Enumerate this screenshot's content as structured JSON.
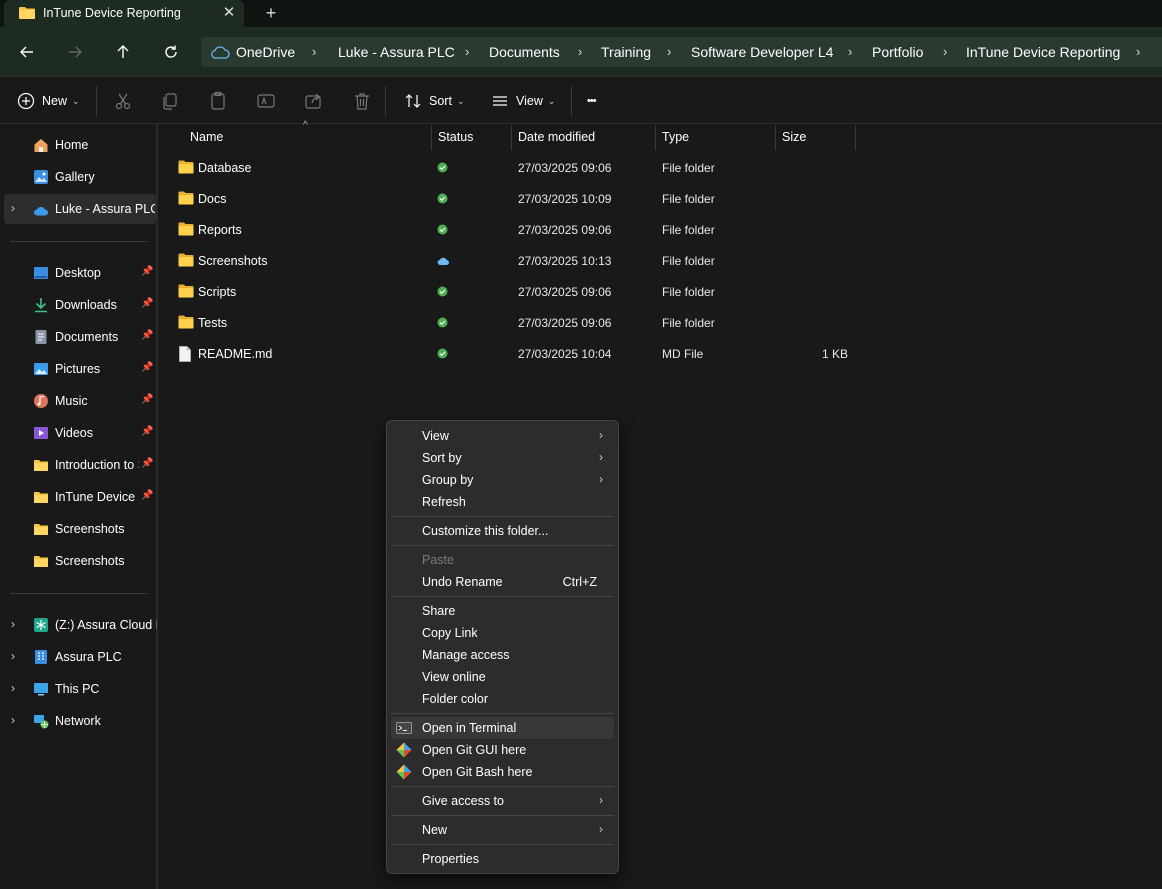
{
  "window": {
    "tab_title": "InTune Device Reporting",
    "new_tab": "+",
    "close": "✕"
  },
  "breadcrumb": [
    "OneDrive",
    "Luke - Assura PLC",
    "Documents",
    "Training",
    "Software Developer L4",
    "Portfolio",
    "InTune Device Reporting"
  ],
  "commandbar": {
    "new_label": "New",
    "sort_label": "Sort",
    "view_label": "View",
    "more": "•••"
  },
  "sidebar": {
    "home": "Home",
    "gallery": "Gallery",
    "onedrive": "Luke - Assura PLC",
    "quick": [
      {
        "label": "Desktop",
        "icon": "desktop-icon"
      },
      {
        "label": "Downloads",
        "icon": "download-icon"
      },
      {
        "label": "Documents",
        "icon": "document-icon"
      },
      {
        "label": "Pictures",
        "icon": "pictures-icon"
      },
      {
        "label": "Music",
        "icon": "music-icon"
      },
      {
        "label": "Videos",
        "icon": "videos-icon"
      },
      {
        "label": "Introduction to S",
        "icon": "folder-icon"
      },
      {
        "label": "InTune Device R",
        "icon": "folder-icon"
      },
      {
        "label": "Screenshots",
        "icon": "folder-icon"
      },
      {
        "label": "Screenshots",
        "icon": "folder-icon"
      }
    ],
    "drives": [
      {
        "label": "(Z:) Assura Cloud D",
        "icon": "network-drive-icon"
      },
      {
        "label": "Assura PLC",
        "icon": "building-icon"
      },
      {
        "label": "This PC",
        "icon": "pc-icon"
      },
      {
        "label": "Network",
        "icon": "network-icon"
      }
    ]
  },
  "columns": {
    "name": "Name",
    "status": "Status",
    "date": "Date modified",
    "type": "Type",
    "size": "Size"
  },
  "files": [
    {
      "name": "Database",
      "status": "synced",
      "date": "27/03/2025 09:06",
      "type": "File folder",
      "size": "",
      "kind": "folder"
    },
    {
      "name": "Docs",
      "status": "synced",
      "date": "27/03/2025 10:09",
      "type": "File folder",
      "size": "",
      "kind": "folder"
    },
    {
      "name": "Reports",
      "status": "synced",
      "date": "27/03/2025 09:06",
      "type": "File folder",
      "size": "",
      "kind": "folder"
    },
    {
      "name": "Screenshots",
      "status": "cloud",
      "date": "27/03/2025 10:13",
      "type": "File folder",
      "size": "",
      "kind": "folder"
    },
    {
      "name": "Scripts",
      "status": "synced",
      "date": "27/03/2025 09:06",
      "type": "File folder",
      "size": "",
      "kind": "folder"
    },
    {
      "name": "Tests",
      "status": "synced",
      "date": "27/03/2025 09:06",
      "type": "File folder",
      "size": "",
      "kind": "folder"
    },
    {
      "name": "README.md",
      "status": "synced",
      "date": "27/03/2025 10:04",
      "type": "MD File",
      "size": "1 KB",
      "kind": "file"
    }
  ],
  "context_menu": {
    "view": "View",
    "sort_by": "Sort by",
    "group_by": "Group by",
    "refresh": "Refresh",
    "customize": "Customize this folder...",
    "paste": "Paste",
    "undo_rename": "Undo Rename",
    "undo_shortcut": "Ctrl+Z",
    "share": "Share",
    "copy_link": "Copy Link",
    "manage_access": "Manage access",
    "view_online": "View online",
    "folder_color": "Folder color",
    "open_terminal": "Open in Terminal",
    "git_gui": "Open Git GUI here",
    "git_bash": "Open Git Bash here",
    "give_access": "Give access to",
    "new": "New",
    "properties": "Properties"
  },
  "colors": {
    "folder": "#f6c343",
    "sync_green": "#4caf50",
    "cloud_blue": "#6fb8f0",
    "accent_bar": "#1d2b21"
  }
}
